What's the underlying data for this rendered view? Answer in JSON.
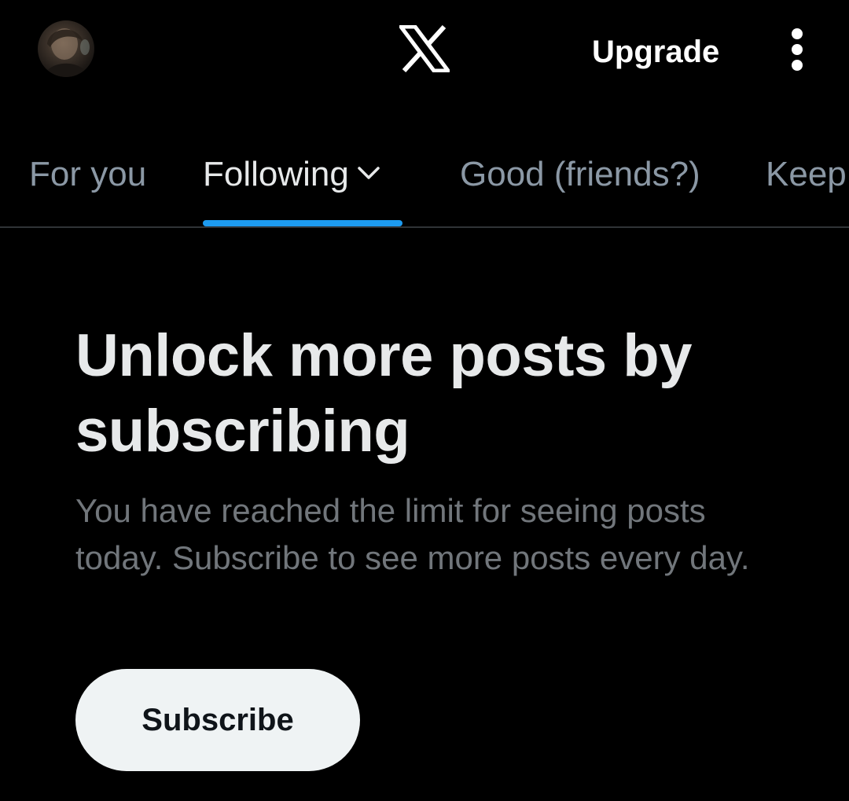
{
  "header": {
    "upgrade_label": "Upgrade"
  },
  "tabs": [
    {
      "label": "For you",
      "active": false
    },
    {
      "label": "Following",
      "active": true
    },
    {
      "label": "Good (friends?)",
      "active": false
    },
    {
      "label": "Keep",
      "active": false
    }
  ],
  "main": {
    "title": "Unlock more posts by subscribing",
    "description": "You have reached the limit for seeing posts today. Subscribe to see more posts every day.",
    "subscribe_label": "Subscribe"
  },
  "colors": {
    "background": "#000000",
    "accent": "#1d9bf0",
    "primary_text": "#e7e9ea",
    "secondary_text": "#71767b",
    "button_bg": "#eff3f4"
  },
  "icons": {
    "logo": "x-logo-icon",
    "menu": "more-vertical-icon",
    "dropdown": "chevron-down-icon"
  }
}
